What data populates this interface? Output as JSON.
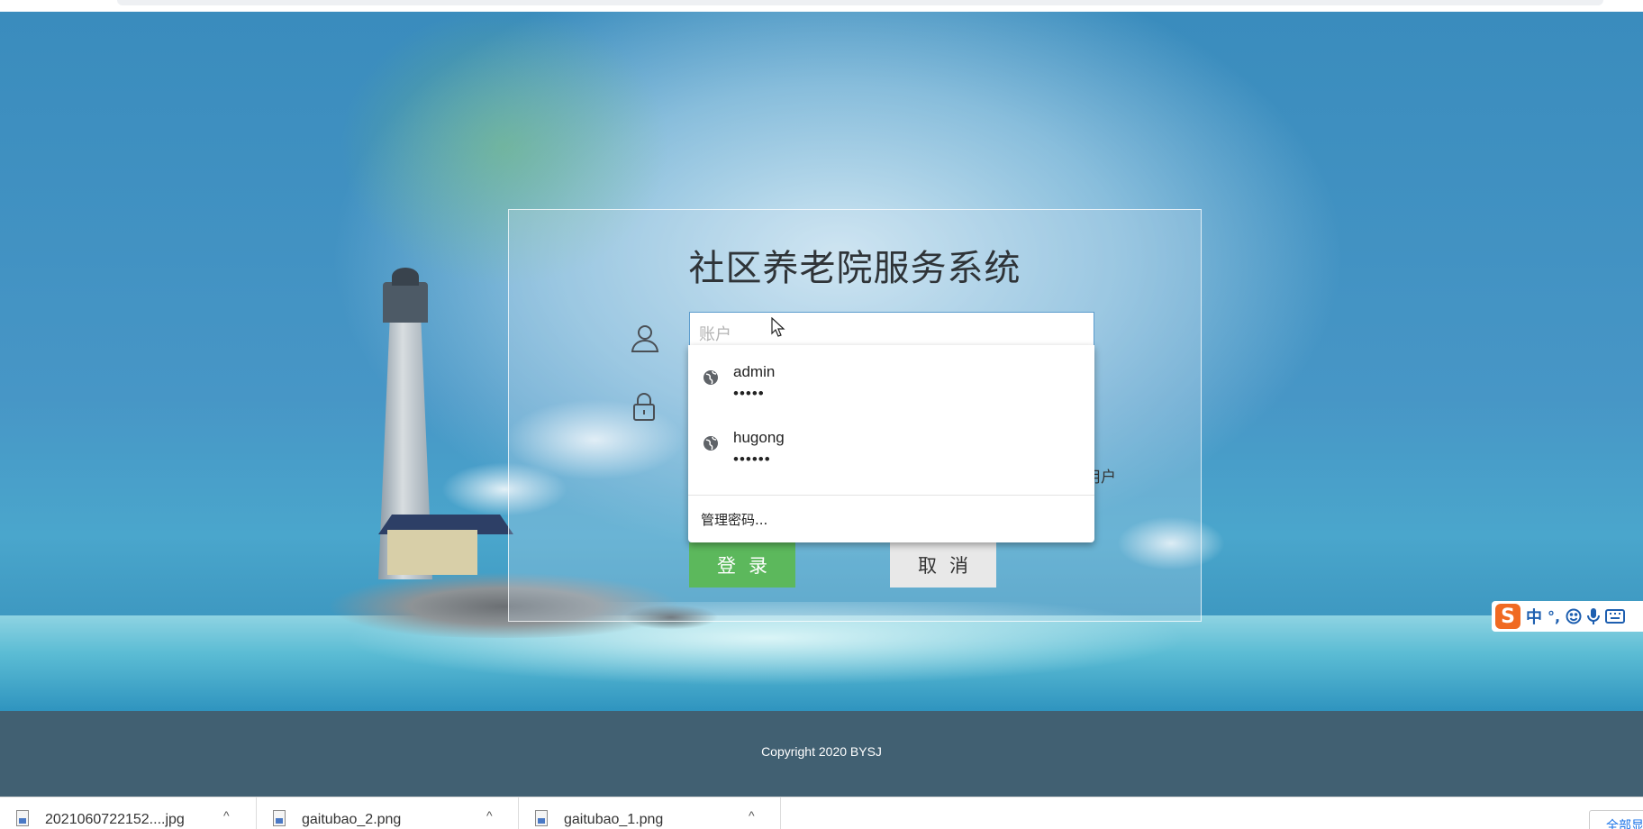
{
  "app": {
    "title": "社区养老院服务系统"
  },
  "login": {
    "account_placeholder": "账户",
    "account_value": "",
    "remember_label_partial": "用户",
    "login_label": "登录",
    "cancel_label": "取消"
  },
  "password_dropdown": {
    "items": [
      {
        "username": "admin",
        "masked_password": "•••••"
      },
      {
        "username": "hugong",
        "masked_password": "••••••"
      }
    ],
    "manage_label": "管理密码..."
  },
  "ime": {
    "logo": "S",
    "mode": "中",
    "punct": "°,"
  },
  "footer": {
    "copyright": "Copyright 2020 BYSJ"
  },
  "downloads": {
    "items": [
      {
        "name": "2021060722152....jpg"
      },
      {
        "name": "gaitubao_2.png"
      },
      {
        "name": "gaitubao_1.png"
      }
    ],
    "show_all": "全部显示"
  },
  "colors": {
    "login_button": "#5cb85c",
    "cancel_button": "#e8e8e8",
    "footer_bg": "#416072",
    "input_focus_border": "#5c9ccd",
    "ime_logo": "#f06a22"
  },
  "icons": {
    "user": "user-icon",
    "lock": "lock-icon",
    "globe": "globe-icon",
    "cursor": "mouse-pointer-icon",
    "file": "file-icon",
    "caret": "chevron-up-icon"
  }
}
